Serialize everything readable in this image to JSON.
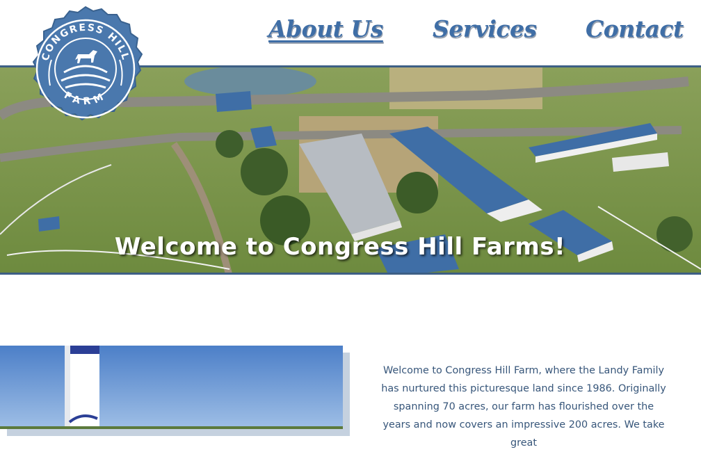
{
  "logo": {
    "top_text": "CONGRESS HILL",
    "bottom_text": "FARM",
    "icon": "horse-on-hills-icon"
  },
  "nav": {
    "items": [
      {
        "label": "About Us",
        "active": true
      },
      {
        "label": "Services",
        "active": false
      },
      {
        "label": "Contact",
        "active": false
      }
    ]
  },
  "hero": {
    "title": "Welcome to Congress Hill Farms!"
  },
  "about": {
    "text": "Welcome to Congress Hill Farm, where the Landy Family has nurtured this picturesque land since 1986. Originally spanning 70 acres, our farm has flourished over the years and now covers an impressive 200 acres. We take great"
  },
  "colors": {
    "brand_blue": "#3f6ea6",
    "text_blue": "#37567a",
    "border_blue": "#3d5f85"
  }
}
